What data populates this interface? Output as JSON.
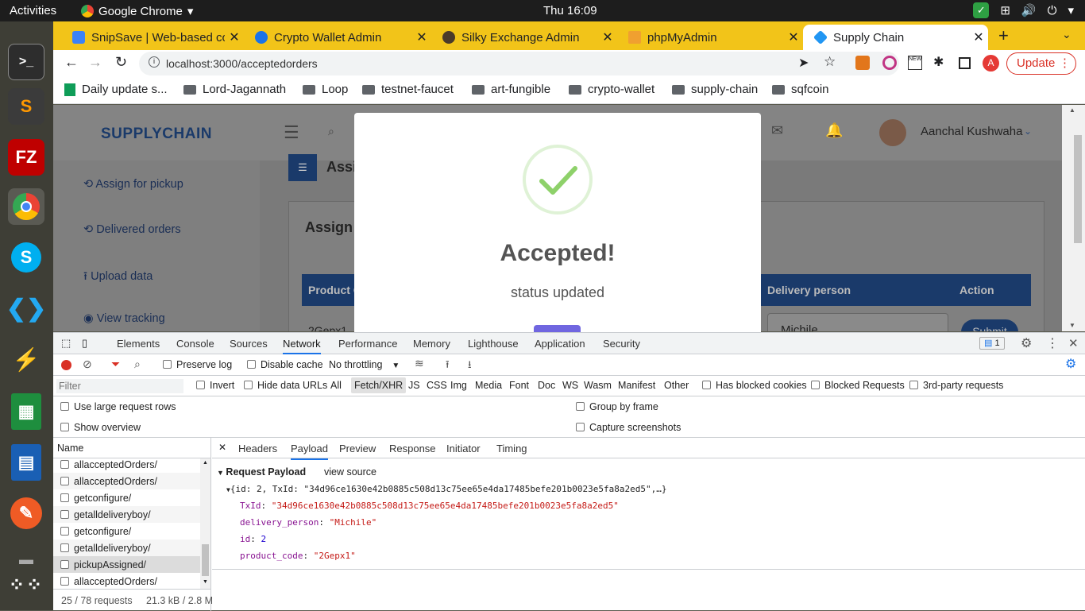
{
  "os": {
    "activities": "Activities",
    "app_name": "Google Chrome",
    "clock": "Thu 16:09"
  },
  "tabs": [
    {
      "title": "SnipSave | Web-based co",
      "color": "#3b82f6"
    },
    {
      "title": "Crypto Wallet Admin",
      "color": "#1a73e8"
    },
    {
      "title": "Silky Exchange Admin",
      "color": "#4a3a2a"
    },
    {
      "title": "phpMyAdmin",
      "color": "#f0a030"
    },
    {
      "title": "Supply Chain",
      "color": "#2196f3"
    }
  ],
  "address": {
    "url": "localhost:3000/acceptedorders",
    "update_label": "Update",
    "profile_initial": "A"
  },
  "bookmarks": [
    "Daily update s...",
    "Lord-Jagannath",
    "Loop",
    "testnet-faucet",
    "art-fungible",
    "crypto-wallet",
    "supply-chain",
    "sqfcoin"
  ],
  "app": {
    "brand": "SUPPLYCHAIN",
    "user": "Aanchal Kushwaha",
    "sidebar": [
      "Assign for pickup",
      "Delivered orders",
      "Upload data",
      "View tracking"
    ],
    "page_heading": "Assi",
    "card_title": "Assign",
    "table_headers": {
      "product": "Product C",
      "delivery": "Delivery person",
      "action": "Action"
    },
    "row": {
      "product": "2Gepx1",
      "delivery": "Michile",
      "action": "Submit"
    }
  },
  "modal": {
    "title": "Accepted!",
    "message": "status updated"
  },
  "devtools": {
    "tabs": [
      "Elements",
      "Console",
      "Sources",
      "Network",
      "Performance",
      "Memory",
      "Lighthouse",
      "Application",
      "Security"
    ],
    "active_tab": "Network",
    "issues_count": "1",
    "preserve_log": "Preserve log",
    "disable_cache": "Disable cache",
    "throttling": "No throttling",
    "filter_placeholder": "Filter",
    "invert": "Invert",
    "hide_data_urls": "Hide data URLs",
    "types": [
      "All",
      "Fetch/XHR",
      "JS",
      "CSS",
      "Img",
      "Media",
      "Font",
      "Doc",
      "WS",
      "Wasm",
      "Manifest",
      "Other"
    ],
    "active_type": "Fetch/XHR",
    "has_blocked_cookies": "Has blocked cookies",
    "blocked_requests": "Blocked Requests",
    "third_party": "3rd-party requests",
    "large_rows": "Use large request rows",
    "show_overview": "Show overview",
    "group_by_frame": "Group by frame",
    "capture_screenshots": "Capture screenshots",
    "name_header": "Name",
    "requests": [
      "allacceptedOrders/",
      "allacceptedOrders/",
      "getconfigure/",
      "getalldeliveryboy/",
      "getconfigure/",
      "getalldeliveryboy/",
      "pickupAssigned/",
      "allacceptedOrders/"
    ],
    "selected_request": "pickupAssigned/",
    "status_requests": "25 / 78 requests",
    "status_size": "21.3 kB / 2.8 M",
    "detail_tabs": [
      "Headers",
      "Payload",
      "Preview",
      "Response",
      "Initiator",
      "Timing"
    ],
    "active_detail": "Payload",
    "payload_title": "Request Payload",
    "view_source": "view source",
    "summary": "{id: 2, TxId: \"34d96ce1630e42b0885c508d13c75ee65e4da17485befe201b0023e5fa8a2ed5\",…}",
    "fields": [
      {
        "key": "TxId",
        "value": "\"34d96ce1630e42b0885c508d13c75ee65e4da17485befe201b0023e5fa8a2ed5\"",
        "kind": "string"
      },
      {
        "key": "delivery_person",
        "value": "\"Michile\"",
        "kind": "string"
      },
      {
        "key": "id",
        "value": "2",
        "kind": "number"
      },
      {
        "key": "product_code",
        "value": "\"2Gepx1\"",
        "kind": "string"
      }
    ]
  }
}
